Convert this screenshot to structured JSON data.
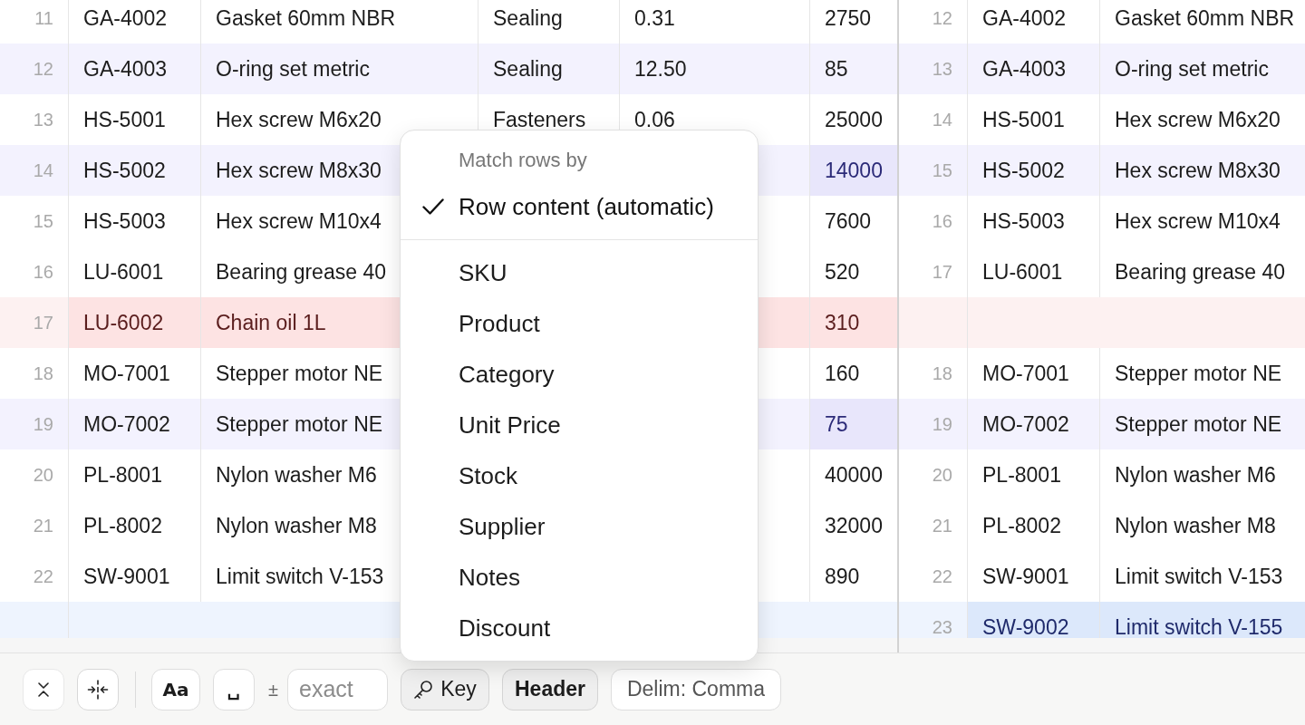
{
  "left_table": {
    "rows": [
      {
        "kind": "unchanged",
        "line": "11",
        "cells": {
          "column_1": {
            "text": "GA-4002",
            "changed": false
          },
          "column_2": {
            "text": "Gasket 60mm NBR",
            "changed": false
          },
          "column_3": {
            "text": "Sealing",
            "changed": false
          },
          "column_4": {
            "text": "0.31",
            "changed": false
          },
          "column_5": {
            "text": "2750",
            "changed": false
          }
        }
      },
      {
        "kind": "modified",
        "line": "12",
        "cells": {
          "column_1": {
            "text": "GA-4003",
            "changed": false
          },
          "column_2": {
            "text": "O-ring set metric",
            "changed": false
          },
          "column_3": {
            "text": "Sealing",
            "changed": false
          },
          "column_4": {
            "text": "12.50",
            "changed": false
          },
          "column_5": {
            "text": "85",
            "changed": false
          }
        }
      },
      {
        "kind": "unchanged",
        "line": "13",
        "cells": {
          "column_1": {
            "text": "HS-5001",
            "changed": false
          },
          "column_2": {
            "text": "Hex screw M6x20",
            "changed": false
          },
          "column_3": {
            "text": "Fasteners",
            "changed": false
          },
          "column_4": {
            "text": "0.06",
            "changed": false
          },
          "column_5": {
            "text": "25000",
            "changed": false
          }
        }
      },
      {
        "kind": "modified",
        "line": "14",
        "cells": {
          "column_1": {
            "text": "HS-5002",
            "changed": false
          },
          "column_2": {
            "text": "Hex screw M8x30",
            "changed": false
          },
          "column_5": {
            "text": "14000",
            "changed": true
          }
        }
      },
      {
        "kind": "unchanged",
        "line": "15",
        "cells": {
          "column_1": {
            "text": "HS-5003",
            "changed": false
          },
          "column_2": {
            "text": "Hex screw M10x4",
            "changed": false
          },
          "column_5": {
            "text": "7600",
            "changed": false
          }
        }
      },
      {
        "kind": "unchanged",
        "line": "16",
        "cells": {
          "column_1": {
            "text": "LU-6001",
            "changed": false
          },
          "column_2": {
            "text": "Bearing grease 40",
            "changed": false
          },
          "column_5": {
            "text": "520",
            "changed": false
          }
        }
      },
      {
        "kind": "deleted",
        "line": "17",
        "cells": {
          "column_1": {
            "text": "LU-6002",
            "changed": false
          },
          "column_2": {
            "text": "Chain oil 1L",
            "changed": false
          },
          "column_5": {
            "text": "310",
            "changed": false
          }
        }
      },
      {
        "kind": "unchanged",
        "line": "18",
        "cells": {
          "column_1": {
            "text": "MO-7001",
            "changed": false
          },
          "column_2": {
            "text": "Stepper motor NE",
            "changed": false
          },
          "column_5": {
            "text": "160",
            "changed": false
          }
        }
      },
      {
        "kind": "modified",
        "line": "19",
        "cells": {
          "column_1": {
            "text": "MO-7002",
            "changed": false
          },
          "column_2": {
            "text": "Stepper motor NE",
            "changed": false
          },
          "column_5": {
            "text": "75",
            "changed": true
          }
        }
      },
      {
        "kind": "unchanged",
        "line": "20",
        "cells": {
          "column_1": {
            "text": "PL-8001",
            "changed": false
          },
          "column_2": {
            "text": "Nylon washer M6",
            "changed": false
          },
          "column_5": {
            "text": "40000",
            "changed": false
          }
        }
      },
      {
        "kind": "unchanged",
        "line": "21",
        "cells": {
          "column_1": {
            "text": "PL-8002",
            "changed": false
          },
          "column_2": {
            "text": "Nylon washer M8",
            "changed": false
          },
          "column_5": {
            "text": "32000",
            "changed": false
          }
        }
      },
      {
        "kind": "unchanged",
        "line": "22",
        "cells": {
          "column_1": {
            "text": "SW-9001",
            "changed": false
          },
          "column_2": {
            "text": "Limit switch V-153",
            "changed": false
          },
          "column_5": {
            "text": "890",
            "changed": false
          }
        }
      },
      {
        "kind": "gap",
        "deleted": false
      }
    ]
  },
  "right_table": {
    "rows": [
      {
        "kind": "unchanged",
        "line": "12",
        "cells": {
          "column_1": {
            "text": "GA-4002",
            "changed": false
          },
          "column_2": {
            "text": "Gasket 60mm NBR",
            "changed": false
          }
        }
      },
      {
        "kind": "modified",
        "line": "13",
        "cells": {
          "column_1": {
            "text": "GA-4003",
            "changed": false
          },
          "column_2": {
            "text": "O-ring set metric",
            "changed": false
          }
        }
      },
      {
        "kind": "unchanged",
        "line": "14",
        "cells": {
          "column_1": {
            "text": "HS-5001",
            "changed": false
          },
          "column_2": {
            "text": "Hex screw M6x20",
            "changed": false
          }
        }
      },
      {
        "kind": "modified",
        "line": "15",
        "cells": {
          "column_1": {
            "text": "HS-5002",
            "changed": false
          },
          "column_2": {
            "text": "Hex screw M8x30",
            "changed": false
          }
        }
      },
      {
        "kind": "unchanged",
        "line": "16",
        "cells": {
          "column_1": {
            "text": "HS-5003",
            "changed": false
          },
          "column_2": {
            "text": "Hex screw M10x4",
            "changed": false
          }
        }
      },
      {
        "kind": "unchanged",
        "line": "17",
        "cells": {
          "column_1": {
            "text": "LU-6001",
            "changed": false
          },
          "column_2": {
            "text": "Bearing grease 40",
            "changed": false
          }
        }
      },
      {
        "kind": "gap",
        "deleted": true
      },
      {
        "kind": "unchanged",
        "line": "18",
        "cells": {
          "column_1": {
            "text": "MO-7001",
            "changed": false
          },
          "column_2": {
            "text": "Stepper motor NE",
            "changed": false
          }
        }
      },
      {
        "kind": "modified",
        "line": "19",
        "cells": {
          "column_1": {
            "text": "MO-7002",
            "changed": false
          },
          "column_2": {
            "text": "Stepper motor NE",
            "changed": false
          }
        }
      },
      {
        "kind": "unchanged",
        "line": "20",
        "cells": {
          "column_1": {
            "text": "PL-8001",
            "changed": false
          },
          "column_2": {
            "text": "Nylon washer M6",
            "changed": false
          }
        }
      },
      {
        "kind": "unchanged",
        "line": "21",
        "cells": {
          "column_1": {
            "text": "PL-8002",
            "changed": false
          },
          "column_2": {
            "text": "Nylon washer M8",
            "changed": false
          }
        }
      },
      {
        "kind": "unchanged",
        "line": "22",
        "cells": {
          "column_1": {
            "text": "SW-9001",
            "changed": false
          },
          "column_2": {
            "text": "Limit switch V-153",
            "changed": false
          }
        }
      },
      {
        "kind": "added",
        "line": "23",
        "cells": {
          "column_1": {
            "text": "SW-9002",
            "changed": false
          },
          "column_2": {
            "text": "Limit switch V-155",
            "changed": false
          }
        }
      }
    ]
  },
  "match_menu": {
    "title": "Match rows by",
    "options": [
      {
        "kind": "automatic",
        "label": "Row content (automatic)",
        "selected": true
      },
      {
        "kind": "column",
        "label": "SKU",
        "selected": false
      },
      {
        "kind": "column",
        "label": "Product",
        "selected": false
      },
      {
        "kind": "column",
        "label": "Category",
        "selected": false
      },
      {
        "kind": "column",
        "label": "Unit Price",
        "selected": false
      },
      {
        "kind": "column",
        "label": "Stock",
        "selected": false
      },
      {
        "kind": "column",
        "label": "Supplier",
        "selected": false
      },
      {
        "kind": "column",
        "label": "Notes",
        "selected": false
      },
      {
        "kind": "column",
        "label": "Discount",
        "selected": false
      }
    ]
  },
  "toolbar": {
    "toggles": [
      {
        "label": "Aa",
        "on": false
      },
      {
        "label": "␣",
        "on": false
      }
    ],
    "tolerance": {
      "sign": "±",
      "placeholder": "exact"
    },
    "key_toggle": {
      "label": "Key",
      "on": true
    },
    "header_toggle": {
      "label": "Header",
      "on": true
    },
    "delimiter": {
      "label": "Delim: Comma"
    }
  }
}
